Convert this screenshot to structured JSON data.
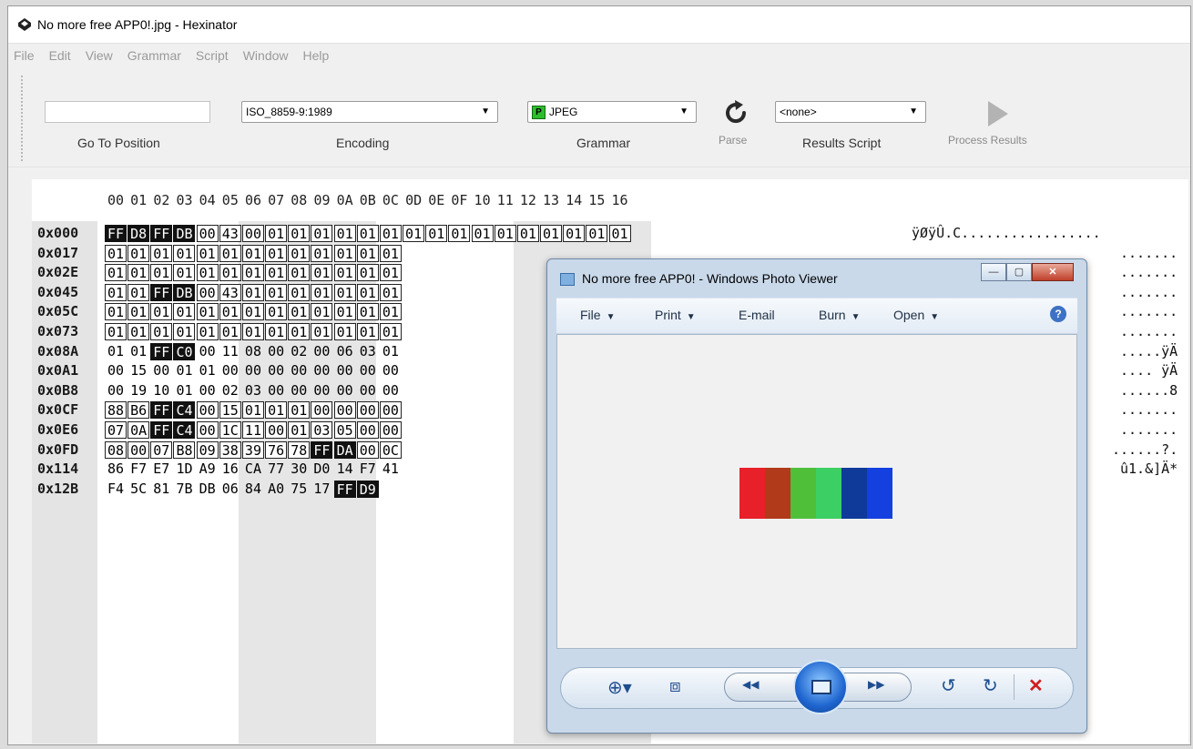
{
  "window": {
    "title": "No more free APP0!.jpg - Hexinator"
  },
  "menu": [
    "File",
    "Edit",
    "View",
    "Grammar",
    "Script",
    "Window",
    "Help"
  ],
  "toolbar": {
    "goto_label": "Go To Position",
    "goto_value": "",
    "encoding_value": "ISO_8859-9:1989",
    "encoding_label": "Encoding",
    "grammar_badge": "P",
    "grammar_value": "JPEG",
    "grammar_label": "Grammar",
    "parse_label": "Parse",
    "results_script_value": "<none>",
    "results_script_label": "Results Script",
    "process_results_label": "Process Results"
  },
  "hex": {
    "columns": [
      "00",
      "01",
      "02",
      "03",
      "04",
      "05",
      "06",
      "07",
      "08",
      "09",
      "0A",
      "0B",
      "0C",
      "0D",
      "0E",
      "0F",
      "10",
      "11",
      "12",
      "13",
      "14",
      "15",
      "16"
    ],
    "rows": [
      {
        "addr": "0x000",
        "bytes": [
          "FF",
          "D8",
          "FF",
          "DB",
          "00",
          "43",
          "00",
          "01",
          "01",
          "01",
          "01",
          "01",
          "01",
          "01",
          "01",
          "01",
          "01",
          "01",
          "01",
          "01",
          "01",
          "01",
          "01"
        ],
        "ascii": "ÿØÿÛ.C................."
      },
      {
        "addr": "0x017",
        "bytes": [
          "01",
          "01",
          "01",
          "01",
          "01",
          "01",
          "01",
          "01",
          "01",
          "01",
          "01",
          "01",
          "01"
        ],
        "ascii": "......."
      },
      {
        "addr": "0x02E",
        "bytes": [
          "01",
          "01",
          "01",
          "01",
          "01",
          "01",
          "01",
          "01",
          "01",
          "01",
          "01",
          "01",
          "01"
        ],
        "ascii": "......."
      },
      {
        "addr": "0x045",
        "bytes": [
          "01",
          "01",
          "FF",
          "DB",
          "00",
          "43",
          "01",
          "01",
          "01",
          "01",
          "01",
          "01",
          "01"
        ],
        "ascii": "......."
      },
      {
        "addr": "0x05C",
        "bytes": [
          "01",
          "01",
          "01",
          "01",
          "01",
          "01",
          "01",
          "01",
          "01",
          "01",
          "01",
          "01",
          "01"
        ],
        "ascii": "......."
      },
      {
        "addr": "0x073",
        "bytes": [
          "01",
          "01",
          "01",
          "01",
          "01",
          "01",
          "01",
          "01",
          "01",
          "01",
          "01",
          "01",
          "01"
        ],
        "ascii": "......."
      },
      {
        "addr": "0x08A",
        "bytes": [
          "01",
          "01",
          "FF",
          "C0",
          "00",
          "11",
          "08",
          "00",
          "02",
          "00",
          "06",
          "03",
          "01"
        ],
        "ascii": ".....ÿÄ"
      },
      {
        "addr": "0x0A1",
        "bytes": [
          "00",
          "15",
          "00",
          "01",
          "01",
          "00",
          "00",
          "00",
          "00",
          "00",
          "00",
          "00",
          "00"
        ],
        "ascii": ".... ÿÄ"
      },
      {
        "addr": "0x0B8",
        "bytes": [
          "00",
          "19",
          "10",
          "01",
          "00",
          "02",
          "03",
          "00",
          "00",
          "00",
          "00",
          "00",
          "00"
        ],
        "ascii": "......8"
      },
      {
        "addr": "0x0CF",
        "bytes": [
          "88",
          "B6",
          "FF",
          "C4",
          "00",
          "15",
          "01",
          "01",
          "01",
          "00",
          "00",
          "00",
          "00"
        ],
        "ascii": "......."
      },
      {
        "addr": "0x0E6",
        "bytes": [
          "07",
          "0A",
          "FF",
          "C4",
          "00",
          "1C",
          "11",
          "00",
          "01",
          "03",
          "05",
          "00",
          "00"
        ],
        "ascii": "......."
      },
      {
        "addr": "0x0FD",
        "bytes": [
          "08",
          "00",
          "07",
          "B8",
          "09",
          "38",
          "39",
          "76",
          "78",
          "FF",
          "DA",
          "00",
          "0C"
        ],
        "ascii": "......?."
      },
      {
        "addr": "0x114",
        "bytes": [
          "86",
          "F7",
          "E7",
          "1D",
          "A9",
          "16",
          "CA",
          "77",
          "30",
          "D0",
          "14",
          "F7",
          "41"
        ],
        "ascii": "û1.&]Ä*"
      },
      {
        "addr": "0x12B",
        "bytes": [
          "F4",
          "5C",
          "81",
          "7B",
          "DB",
          "06",
          "84",
          "A0",
          "75",
          "17",
          "FF",
          "D9"
        ],
        "ascii": ""
      }
    ]
  },
  "photo_viewer": {
    "title": "No more free APP0! - Windows Photo Viewer",
    "menu": [
      {
        "label": "File",
        "dropdown": true
      },
      {
        "label": "Print",
        "dropdown": true
      },
      {
        "label": "E-mail",
        "dropdown": false
      },
      {
        "label": "Burn",
        "dropdown": true
      },
      {
        "label": "Open",
        "dropdown": true
      }
    ],
    "help": "?",
    "image_colors": [
      "#e8202a",
      "#b03a1a",
      "#4fbf3a",
      "#3ccf63",
      "#0f3a9a",
      "#1540e0"
    ],
    "controls": {
      "zoom": "⊕▾",
      "fit": "⧈",
      "prev": "◀◀",
      "next": "▶▶",
      "rotate_ccw": "↺",
      "rotate_cw": "↻",
      "delete": "✕"
    },
    "window_buttons": {
      "minimize": "—",
      "maximize": "▢",
      "close": "✕"
    }
  }
}
